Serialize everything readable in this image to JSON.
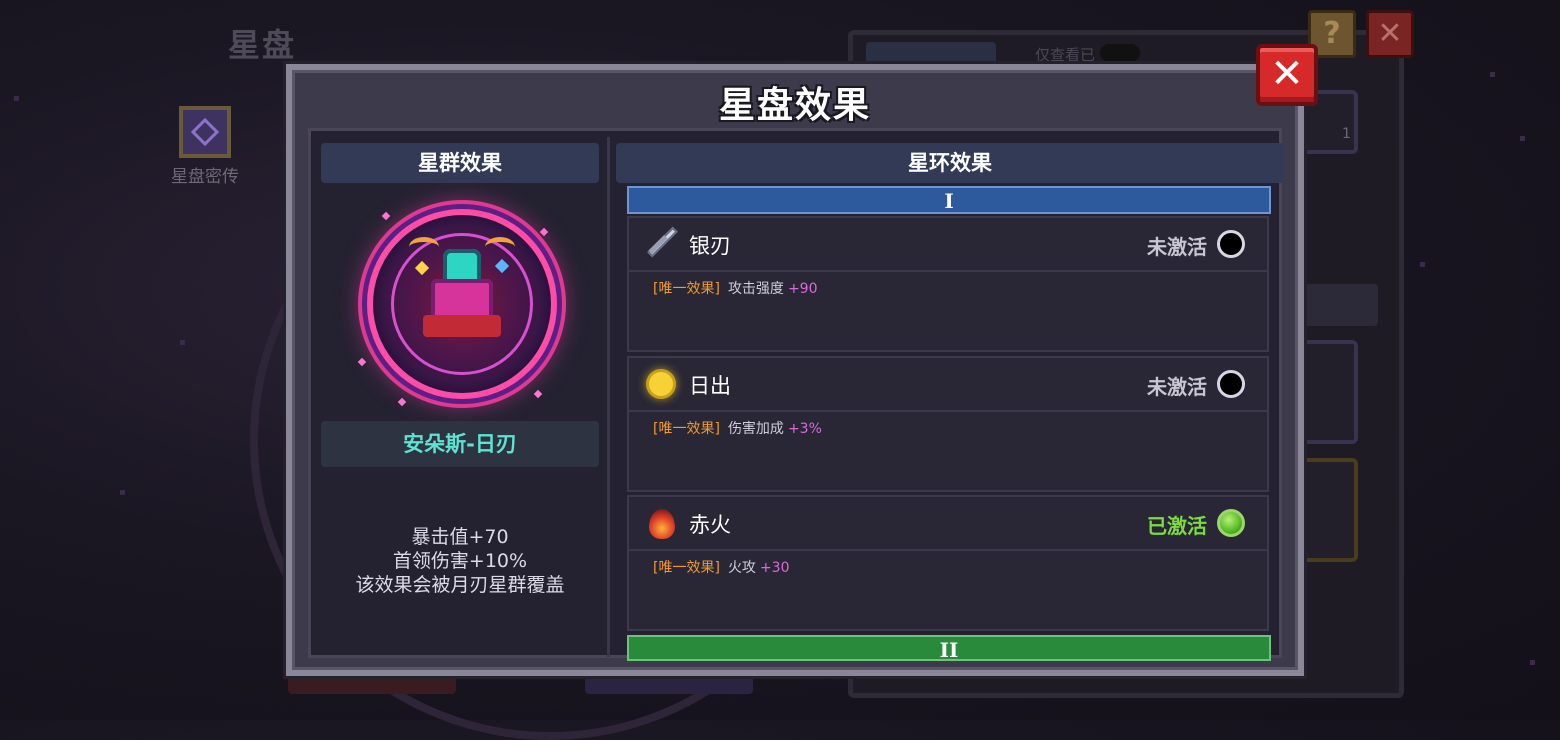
{
  "background": {
    "title": "星盘",
    "secret_label": "星盘密传",
    "filter_label": "仅查看已",
    "slot_count": "1",
    "help_label": "?",
    "close_label": "✕"
  },
  "modal": {
    "title": "星盘效果",
    "close_label": "✕",
    "left": {
      "header": "星群效果",
      "name": "安朵斯-日刃",
      "desc": [
        "暴击值+70",
        "首领伤害+10%",
        "该效果会被月刃星群覆盖"
      ]
    },
    "right": {
      "header": "星环效果",
      "tiers": [
        "I",
        "II"
      ],
      "rings": [
        {
          "name": "银刃",
          "icon": "sword-icon",
          "status": "未激活",
          "active": false,
          "tag": "[唯一效果]",
          "effect": "攻击强度",
          "value": "+90"
        },
        {
          "name": "日出",
          "icon": "sun-icon",
          "status": "未激活",
          "active": false,
          "tag": "[唯一效果]",
          "effect": "伤害加成",
          "value": "+3%"
        },
        {
          "name": "赤火",
          "icon": "fire-icon",
          "status": "已激活",
          "active": true,
          "tag": "[唯一效果]",
          "effect": "火攻",
          "value": "+30"
        }
      ]
    }
  },
  "colors": {
    "accent_cyan": "#5ce3d2",
    "active_green": "#7ddb3e",
    "tag_orange": "#f09a2c",
    "value_purple": "#d86ad8",
    "close_red": "#d62a2a"
  }
}
